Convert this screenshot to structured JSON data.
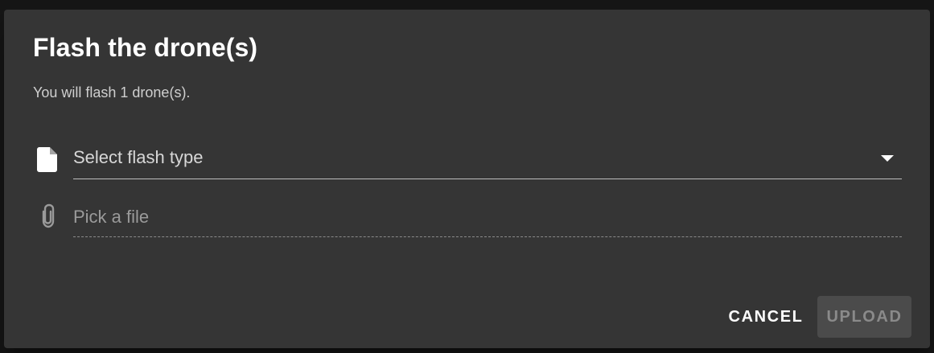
{
  "dialog": {
    "title": "Flash the drone(s)",
    "subtitle": "You will flash 1 drone(s).",
    "flash_type_select": {
      "placeholder": "Select flash type",
      "icon": "file-icon"
    },
    "file_picker": {
      "placeholder": "Pick a file",
      "icon": "paperclip-icon"
    },
    "actions": {
      "cancel_label": "CANCEL",
      "upload_label": "UPLOAD",
      "upload_disabled": true
    }
  },
  "colors": {
    "backdrop": "#161616",
    "dialog_background": "#353535",
    "text_primary": "#ffffff",
    "text_secondary": "#cfcfcf",
    "text_placeholder": "#9a9a9a",
    "disabled_button_background": "#4b4b4b",
    "disabled_button_text": "#8a8a8a"
  }
}
